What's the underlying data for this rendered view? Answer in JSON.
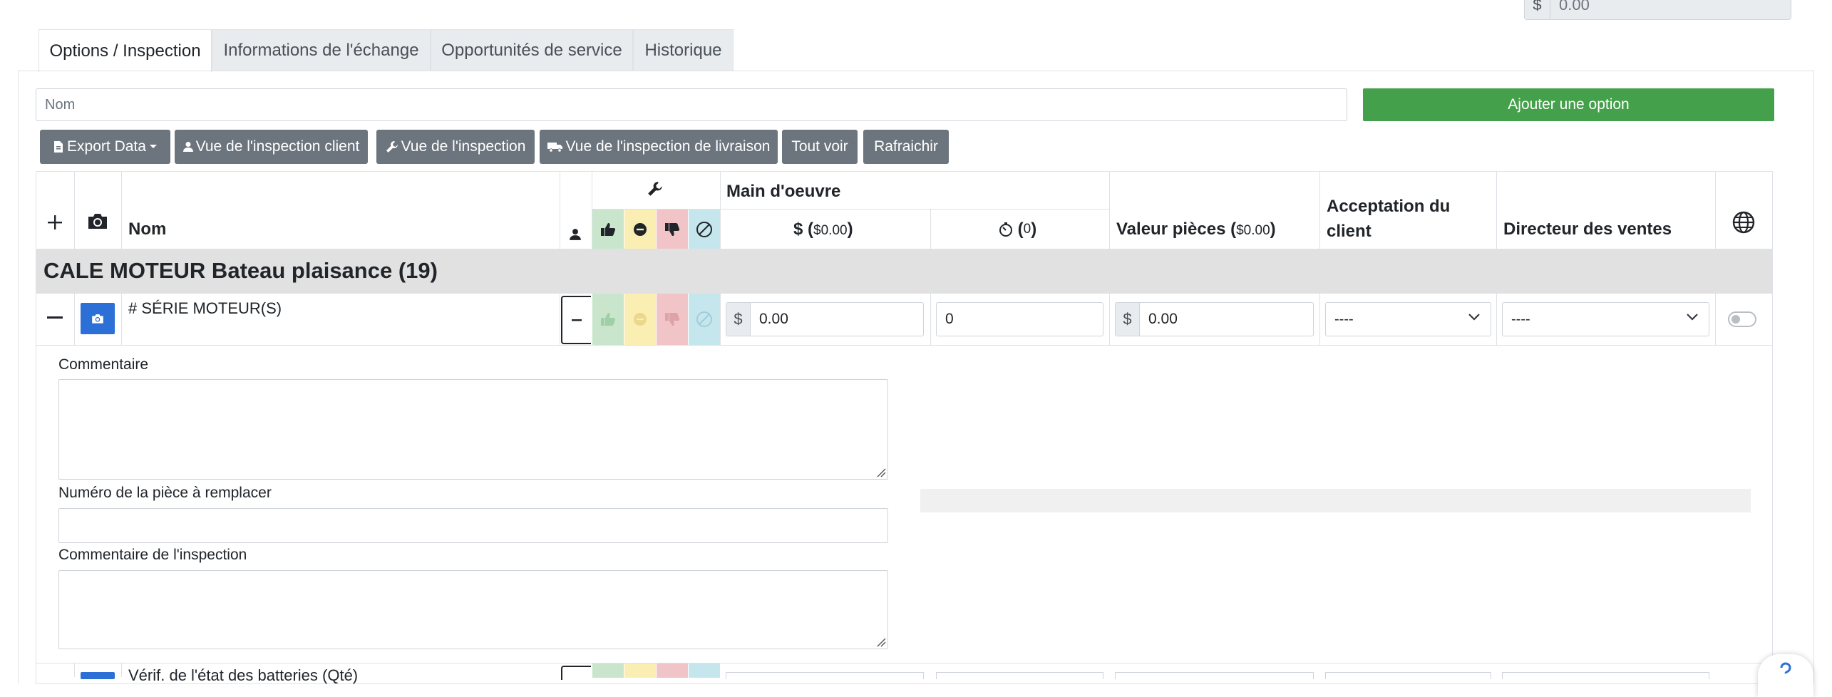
{
  "top_amount": {
    "prefix": "$",
    "value": "0.00"
  },
  "tabs": [
    {
      "label": "Options / Inspection"
    },
    {
      "label": "Informations de l'échange"
    },
    {
      "label": "Opportunités de service"
    },
    {
      "label": "Historique"
    }
  ],
  "name_input": {
    "placeholder": "Nom"
  },
  "add_button": {
    "label": "Ajouter une option"
  },
  "toolbar": {
    "export": "Export Data",
    "client_view": "Vue de l'inspection client",
    "inspection_view": "Vue de l'inspection",
    "delivery_view": "Vue de l'inspection de livraison",
    "show_all": "Tout voir",
    "refresh": "Rafraichir"
  },
  "table": {
    "headers": {
      "name": "Nom",
      "labour": "Main d'oeuvre",
      "labour_cost_label": "$",
      "labour_cost_sum": "$0.00",
      "labour_time_sum": "0",
      "parts_value": "Valeur pièces (",
      "parts_value_sum": "$0.00",
      "parts_value_close": ")",
      "client_acceptance": "Acceptation du client",
      "sales_director": "Directeur des ventes"
    },
    "group": {
      "title": "CALE MOTEUR Bateau plaisance (19)"
    },
    "rows": [
      {
        "name": "# SÉRIE MOTEUR(S)",
        "labour_prefix": "$",
        "labour_cost": "0.00",
        "labour_time": "0",
        "parts_prefix": "$",
        "parts_value": "0.00",
        "client_acceptance": "----",
        "sales_director": "----",
        "published": false,
        "details": {
          "comment_label": "Commentaire",
          "part_number_label": "Numéro de la pièce à remplacer",
          "inspection_comment_label": "Commentaire de l'inspection"
        }
      },
      {
        "name": "Vérif. de l'état des batteries (Qté)"
      }
    ]
  },
  "colors": {
    "add_button": "#44a04a",
    "toolbar_button": "#6c757d",
    "camera_button": "#2c6fd6",
    "status_good": "#c9e6cd",
    "status_warn": "#fbeeb2",
    "status_bad": "#f1c4c7",
    "status_na": "#c6e6ee",
    "group_row": "#e1e1e1"
  }
}
